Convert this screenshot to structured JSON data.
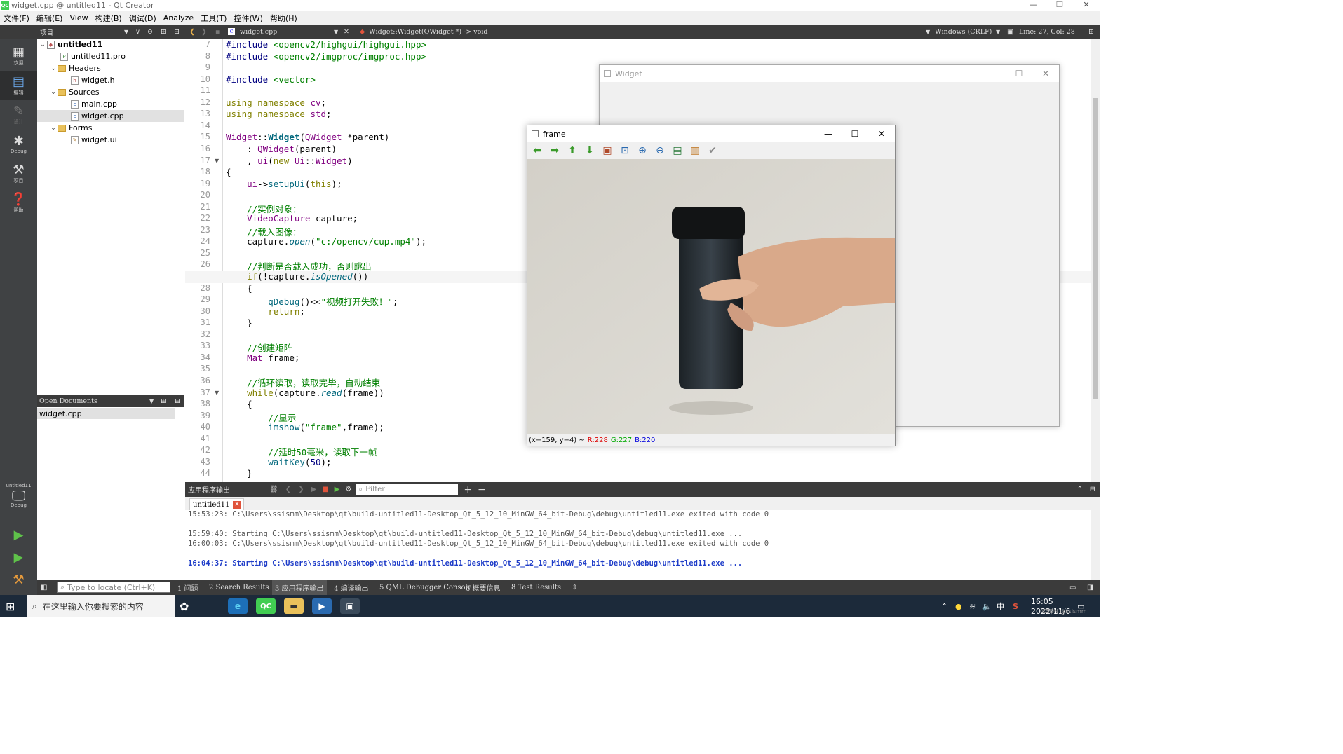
{
  "window": {
    "title": "widget.cpp @ untitled11 - Qt Creator",
    "minimize": "—",
    "maximize": "❐",
    "close": "✕"
  },
  "menu": [
    "文件(F)",
    "编辑(E)",
    "View",
    "构建(B)",
    "调试(D)",
    "Analyze",
    "工具(T)",
    "控件(W)",
    "帮助(H)"
  ],
  "toolbar": {
    "project_label": "项目",
    "file_tab": "widget.cpp",
    "symbol": "Widget::Widget(QWidget *) -> void",
    "encoding": "Windows (CRLF)",
    "cursor_pos": "Line: 27, Col: 28"
  },
  "modes": [
    {
      "label": "欢迎",
      "icon": "grid-icon"
    },
    {
      "label": "编辑",
      "icon": "edit-icon"
    },
    {
      "label": "设计",
      "icon": "pencil-icon"
    },
    {
      "label": "Debug",
      "icon": "bug-icon"
    },
    {
      "label": "项目",
      "icon": "wrench-icon"
    },
    {
      "label": "帮助",
      "icon": "help-icon"
    }
  ],
  "kit": {
    "project": "untitled11",
    "config": "Debug"
  },
  "tree": [
    {
      "label": "untitled11",
      "level": 0,
      "kind": "project",
      "expanded": true
    },
    {
      "label": "untitled11.pro",
      "level": 1,
      "kind": "pro"
    },
    {
      "label": "Headers",
      "level": 1,
      "kind": "folder",
      "expanded": true
    },
    {
      "label": "widget.h",
      "level": 2,
      "kind": "h"
    },
    {
      "label": "Sources",
      "level": 1,
      "kind": "folder",
      "expanded": true
    },
    {
      "label": "main.cpp",
      "level": 2,
      "kind": "cpp"
    },
    {
      "label": "widget.cpp",
      "level": 2,
      "kind": "cpp",
      "selected": true
    },
    {
      "label": "Forms",
      "level": 1,
      "kind": "folder",
      "expanded": true
    },
    {
      "label": "widget.ui",
      "level": 2,
      "kind": "ui"
    }
  ],
  "open_documents": {
    "title": "Open Documents",
    "items": [
      "widget.cpp"
    ]
  },
  "editor": {
    "current_line": 27,
    "folds": [
      17,
      27,
      37
    ],
    "lines": [
      {
        "n": 7,
        "html": "<span class='pp'>#include</span> <span class='inc'>&lt;opencv2/highgui/highgui.hpp&gt;</span>"
      },
      {
        "n": 8,
        "html": "<span class='pp'>#include</span> <span class='inc'>&lt;opencv2/imgproc/imgproc.hpp&gt;</span>"
      },
      {
        "n": 9,
        "html": ""
      },
      {
        "n": 10,
        "html": "<span class='pp'>#include</span> <span class='inc'>&lt;vector&gt;</span>"
      },
      {
        "n": 11,
        "html": ""
      },
      {
        "n": 12,
        "html": "<span class='kw'>using</span> <span class='kw'>namespace</span> <span class='typ'>cv</span>;"
      },
      {
        "n": 13,
        "html": "<span class='kw'>using</span> <span class='kw'>namespace</span> <span class='typ'>std</span>;"
      },
      {
        "n": 14,
        "html": ""
      },
      {
        "n": 15,
        "html": "<span class='typ'>Widget</span>::<span class='bold'>Widget</span>(<span class='typ'>QWidget</span> *parent)"
      },
      {
        "n": 16,
        "html": "    : <span class='typ'>QWidget</span>(parent)"
      },
      {
        "n": 17,
        "html": "    , <span class='typ'>ui</span>(<span class='kw'>new</span> <span class='typ'>Ui</span>::<span class='typ'>Widget</span>)"
      },
      {
        "n": 18,
        "html": "{"
      },
      {
        "n": 19,
        "html": "    <span class='typ'>ui</span>-&gt;<span class='fn'>setupUi</span>(<span class='kw'>this</span>);"
      },
      {
        "n": 20,
        "html": ""
      },
      {
        "n": 21,
        "html": "    <span class='cm'>//实例对象：</span>"
      },
      {
        "n": 22,
        "html": "    <span class='typ'>VideoCapture</span> capture;"
      },
      {
        "n": 23,
        "html": "    <span class='cm'>//载入图像：</span>"
      },
      {
        "n": 24,
        "html": "    capture.<span class='it'>open</span>(<span class='str'>\"c:/opencv/cup.mp4\"</span>);"
      },
      {
        "n": 25,
        "html": ""
      },
      {
        "n": 26,
        "html": "    <span class='cm'>//判断是否载入成功，否则跳出</span>"
      },
      {
        "n": 27,
        "html": "    <span class='kw'>if</span>(!capture.<span class='it'>isOpened</span>())"
      },
      {
        "n": 28,
        "html": "    {"
      },
      {
        "n": 29,
        "html": "        <span class='fn'>qDebug</span>()&lt;&lt;<span class='str'>\"视频打开失败！\"</span>;"
      },
      {
        "n": 30,
        "html": "        <span class='kw'>return</span>;"
      },
      {
        "n": 31,
        "html": "    }"
      },
      {
        "n": 32,
        "html": ""
      },
      {
        "n": 33,
        "html": "    <span class='cm'>//创建矩阵</span>"
      },
      {
        "n": 34,
        "html": "    <span class='typ'>Mat</span> frame;"
      },
      {
        "n": 35,
        "html": ""
      },
      {
        "n": 36,
        "html": "    <span class='cm'>//循环读取，读取完毕，自动结束</span>"
      },
      {
        "n": 37,
        "html": "    <span class='kw'>while</span>(capture.<span class='it'>read</span>(frame))"
      },
      {
        "n": 38,
        "html": "    {"
      },
      {
        "n": 39,
        "html": "        <span class='cm'>//显示</span>"
      },
      {
        "n": 40,
        "html": "        <span class='fn'>imshow</span>(<span class='str'>\"frame\"</span>,frame);"
      },
      {
        "n": 41,
        "html": ""
      },
      {
        "n": 42,
        "html": "        <span class='cm'>//延时50毫米，读取下一帧</span>"
      },
      {
        "n": 43,
        "html": "        <span class='fn'>waitKey</span>(<span class='num'>50</span>);"
      },
      {
        "n": 44,
        "html": "    }"
      }
    ]
  },
  "widget_window": {
    "title": "Widget"
  },
  "frame_window": {
    "title": "frame",
    "status_pos": "(x=159, y=4) ~",
    "r": "R:228",
    "g": "G:227",
    "b": "B:220",
    "tools": [
      "arrow-left-icon",
      "arrow-right-icon",
      "arrow-up-icon",
      "arrow-down-icon",
      "image-icon",
      "zoom-fit-icon",
      "zoom-in-icon",
      "zoom-out-icon",
      "save-icon",
      "copy-icon",
      "properties-icon"
    ]
  },
  "output": {
    "title": "应用程序输出",
    "filter_placeholder": "Filter",
    "tab": "untitled11",
    "lines": [
      "15:53:23: C:\\Users\\ssismm\\Desktop\\qt\\build-untitled11-Desktop_Qt_5_12_10_MinGW_64_bit-Debug\\debug\\untitled11.exe exited with code 0",
      "15:59:40: Starting C:\\Users\\ssismm\\Desktop\\qt\\build-untitled11-Desktop_Qt_5_12_10_MinGW_64_bit-Debug\\debug\\untitled11.exe ...",
      "16:00:03: C:\\Users\\ssismm\\Desktop\\qt\\build-untitled11-Desktop_Qt_5_12_10_MinGW_64_bit-Debug\\debug\\untitled11.exe exited with code 0",
      "16:04:37: Starting C:\\Users\\ssismm\\Desktop\\qt\\build-untitled11-Desktop_Qt_5_12_10_MinGW_64_bit-Debug\\debug\\untitled11.exe ..."
    ]
  },
  "statusbar": {
    "locate_placeholder": "Type to locate (Ctrl+K)",
    "panes": [
      "1 问题",
      "2 Search Results",
      "3 应用程序输出",
      "4 编译输出",
      "5 QML Debugger Console",
      "6 概要信息",
      "8 Test Results"
    ]
  },
  "taskbar": {
    "search_placeholder": "在这里输入你要搜索的内容",
    "time": "16:05",
    "date": "2022/11/6",
    "ime": "中",
    "watermark": "CSDN @ssismm"
  }
}
